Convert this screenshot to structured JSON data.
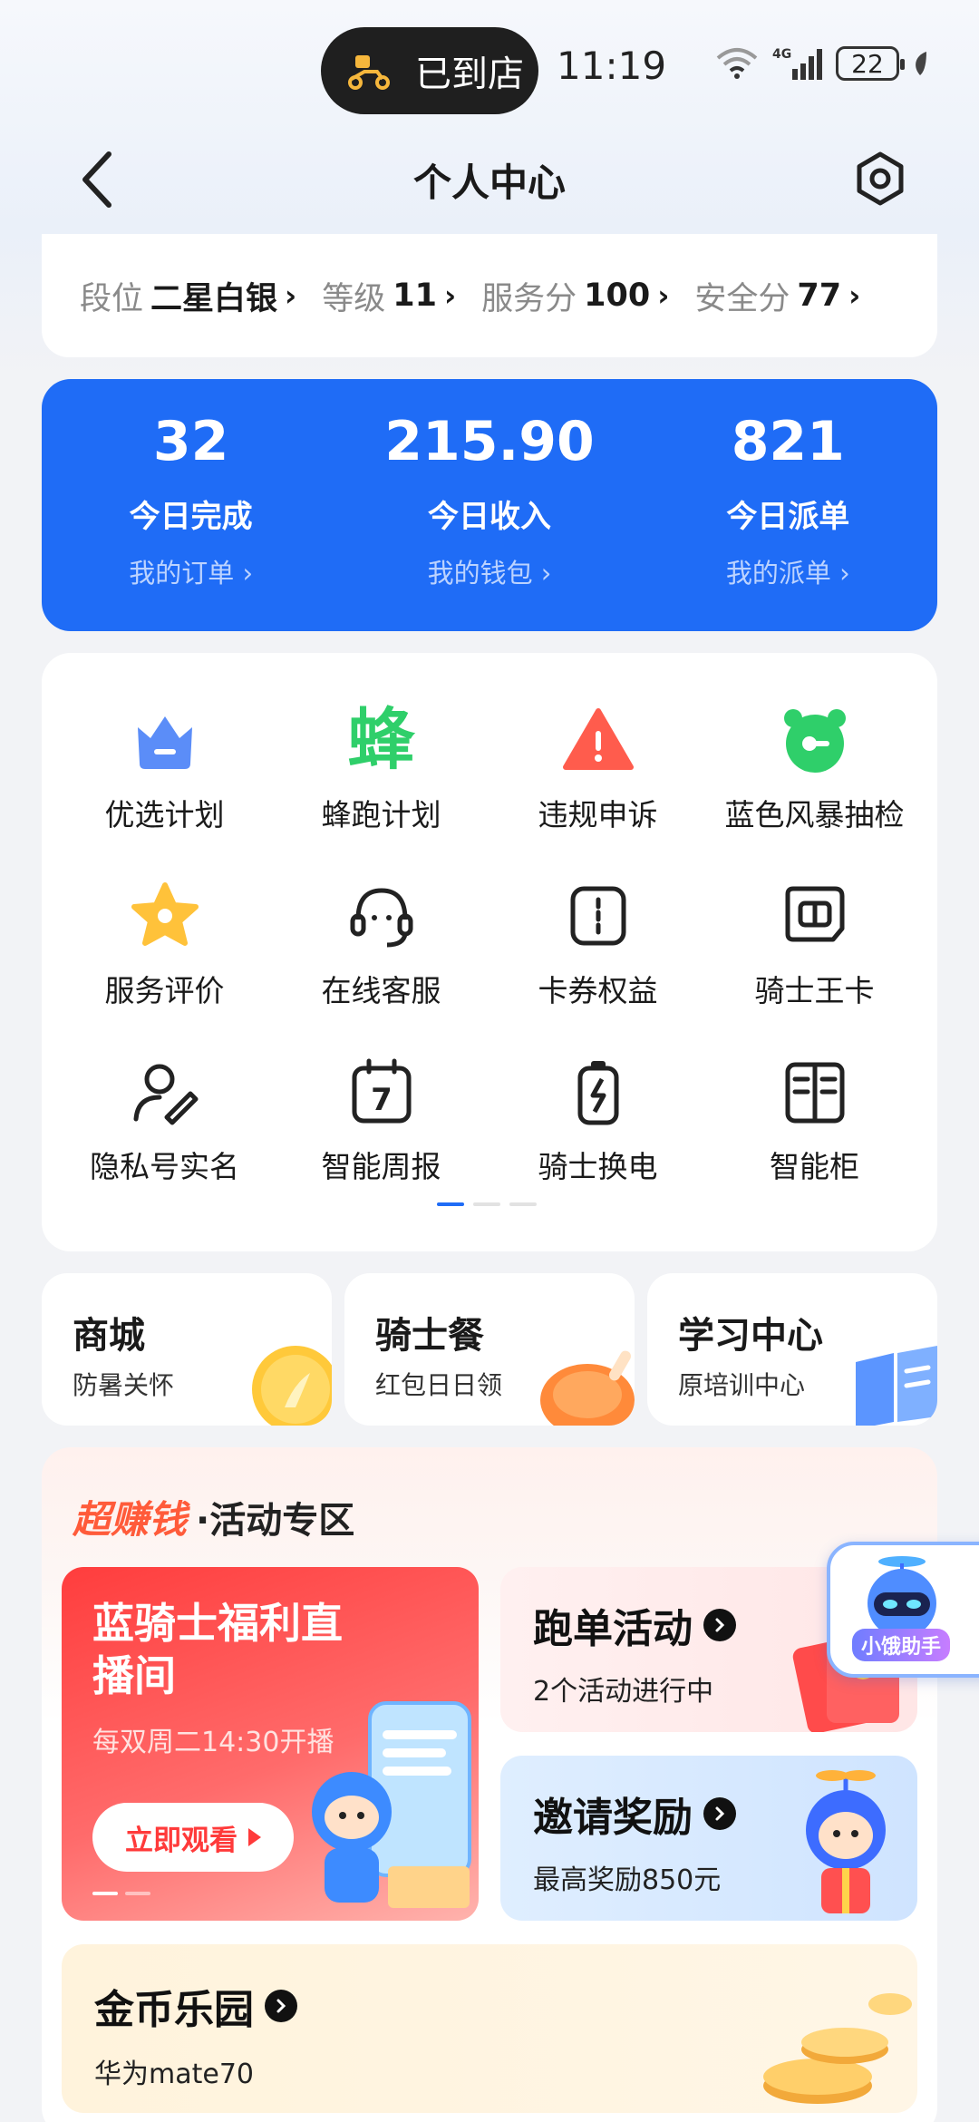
{
  "status_bar": {
    "pill_text": "已到店",
    "time": "11:19",
    "network": "4G",
    "battery": "22"
  },
  "header": {
    "title": "个人中心"
  },
  "rank": [
    {
      "label": "段位",
      "value": "二星白银"
    },
    {
      "label": "等级",
      "value": "11"
    },
    {
      "label": "服务分",
      "value": "100"
    },
    {
      "label": "安全分",
      "value": "77"
    }
  ],
  "stats": [
    {
      "value": "32",
      "name": "今日完成",
      "link": "我的订单 ›"
    },
    {
      "value": "215.90",
      "name": "今日收入",
      "link": "我的钱包 ›"
    },
    {
      "value": "821",
      "name": "今日派单",
      "link": "我的派单 ›"
    }
  ],
  "services": [
    {
      "label": "优选计划",
      "icon": "crown-icon"
    },
    {
      "label": "蜂跑计划",
      "icon": "bee-run-icon",
      "glyph": "蜂"
    },
    {
      "label": "违规申诉",
      "icon": "warning-icon"
    },
    {
      "label": "蓝色风暴抽检",
      "icon": "alarm-clock-icon"
    },
    {
      "label": "服务评价",
      "icon": "star-badge-icon"
    },
    {
      "label": "在线客服",
      "icon": "headset-icon"
    },
    {
      "label": "卡券权益",
      "icon": "coupon-icon"
    },
    {
      "label": "骑士王卡",
      "icon": "sim-card-icon"
    },
    {
      "label": "隐私号实名",
      "icon": "user-shield-icon"
    },
    {
      "label": "智能周报",
      "icon": "calendar-icon",
      "glyph": "7"
    },
    {
      "label": "骑士换电",
      "icon": "battery-swap-icon"
    },
    {
      "label": "智能柜",
      "icon": "cabinet-icon"
    }
  ],
  "features": [
    {
      "title": "商城",
      "subtitle": "防暑关怀",
      "icon": "gold-coin-icon"
    },
    {
      "title": "骑士餐",
      "subtitle": "红包日日领",
      "icon": "roast-chicken-icon"
    },
    {
      "title": "学习中心",
      "subtitle": "原培训中心",
      "icon": "book-icon"
    }
  ],
  "activity": {
    "title_hot": "超赚钱",
    "title_rest": "·活动专区",
    "live": {
      "title": "蓝骑士福利直播间",
      "subtitle": "每双周二14:30开播",
      "button": "立即观看"
    },
    "run": {
      "title": "跑单活动",
      "subtitle": "2个活动进行中"
    },
    "invite": {
      "title": "邀请奖励",
      "subtitle": "最高奖励850元"
    },
    "coin": {
      "title": "金币乐园",
      "subtitle": "华为mate70"
    }
  },
  "assistant": {
    "label": "小饿助手"
  },
  "colors": {
    "primary_blue": "#1f6cf6",
    "hot_red": "#ff5b3a"
  }
}
